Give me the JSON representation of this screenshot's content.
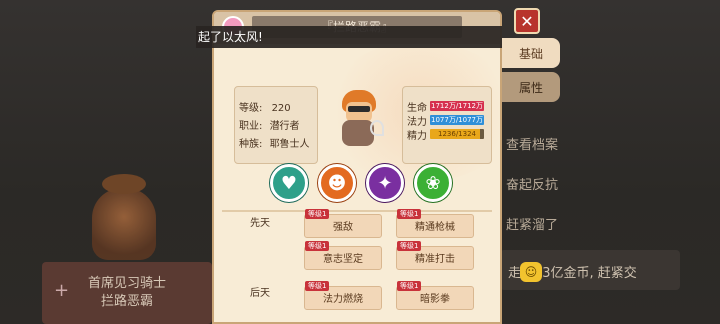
{
  "panel": {
    "title": "『拦路恶霸』",
    "notice": "起了以太风!"
  },
  "tabs": [
    {
      "label": "基础",
      "active": true
    },
    {
      "label": "属性",
      "active": false
    }
  ],
  "info": {
    "level_label": "等级:",
    "level_value": "220",
    "job_label": "职业:",
    "job_value": "潜行者",
    "race_label": "种族:",
    "race_value": "耶鲁士人"
  },
  "stats": {
    "hp_label": "生命",
    "hp_value": "1712万/1712万",
    "mp_label": "法力",
    "mp_value": "1077万/1077万",
    "sp_label": "精力",
    "sp_value": "1236/1324",
    "sp_fraction": 0.93
  },
  "skills": [
    {
      "icon": "heart-sparkle-icon",
      "glyph": "♥"
    },
    {
      "icon": "demon-mask-icon",
      "glyph": "☻"
    },
    {
      "icon": "dark-dragon-icon",
      "glyph": "✦"
    },
    {
      "icon": "leaf-beast-icon",
      "glyph": "❀"
    }
  ],
  "innate": {
    "label": "先天",
    "traits": [
      {
        "level": "等级1",
        "name": "强敌"
      },
      {
        "level": "等级1",
        "name": "精通枪械"
      },
      {
        "level": "等级1",
        "name": "意志坚定"
      },
      {
        "level": "等级1",
        "name": "精准打击"
      }
    ]
  },
  "acquired": {
    "label": "后天",
    "traits": [
      {
        "level": "等级1",
        "name": "法力燃烧"
      },
      {
        "level": "等级1",
        "name": "暗影拳"
      }
    ]
  },
  "background": {
    "card_line1": "首席见习骑士",
    "card_line2": "拦路恶霸",
    "menu": [
      "查看档案",
      "奋起反抗",
      "赶紧溜了"
    ],
    "bar_text": "走, 的3亿金币, 赶紧交"
  },
  "colors": {
    "panel_bg": "#f8ecd6",
    "close_red": "#b8342c",
    "hp_bar": "#d6304e",
    "mp_bar": "#2f8fd8",
    "sp_bar": "#e9a71a"
  }
}
